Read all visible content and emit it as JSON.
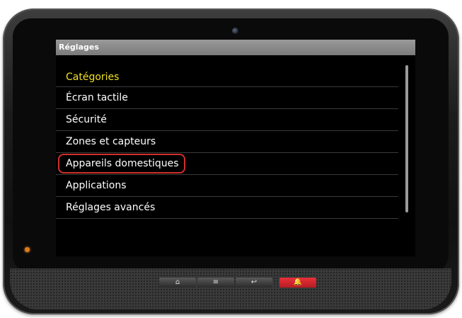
{
  "screen": {
    "title": "Réglages",
    "section_header": "Catégories",
    "items": [
      {
        "label": "Écran tactile"
      },
      {
        "label": "Sécurité"
      },
      {
        "label": "Zones et capteurs"
      },
      {
        "label": "Appareils domestiques",
        "highlighted": true
      },
      {
        "label": "Applications"
      },
      {
        "label": "Réglages avancés"
      }
    ]
  },
  "hardware_buttons": {
    "home": "⌂",
    "menu": "≡",
    "back": "↩",
    "alarm": "🔔"
  },
  "colors": {
    "header_yellow": "#f0e020",
    "highlight_ring": "#d0302b",
    "alarm_button": "#e8303a",
    "led": "#e07a18"
  }
}
